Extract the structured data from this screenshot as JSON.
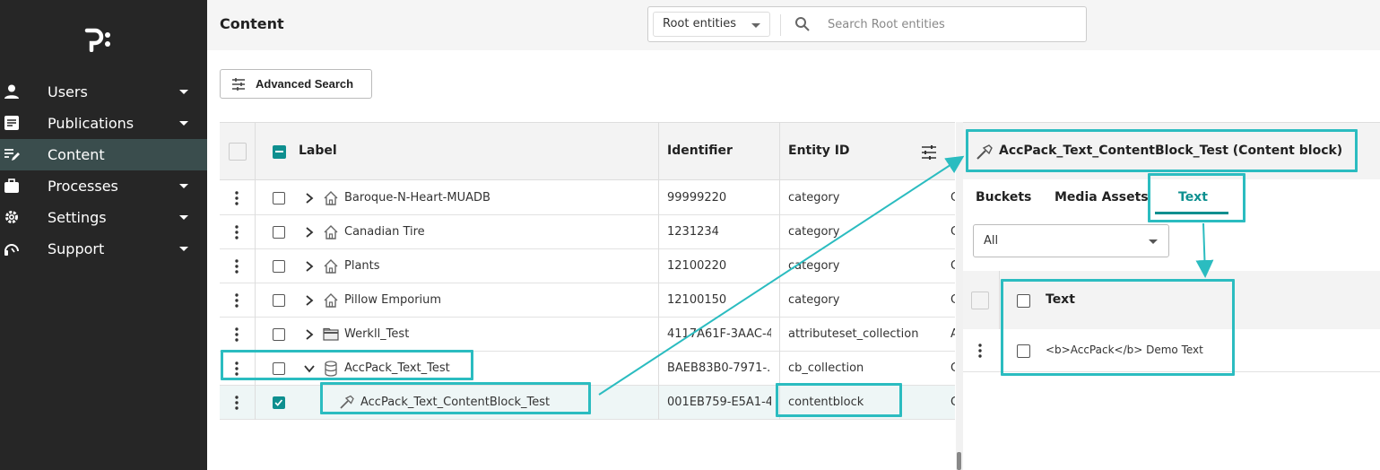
{
  "sidebar": {
    "logo_text": "p:",
    "items": [
      {
        "label": "Users",
        "icon": "person-icon",
        "has_caret": true,
        "active": false
      },
      {
        "label": "Publications",
        "icon": "document-icon",
        "has_caret": true,
        "active": false
      },
      {
        "label": "Content",
        "icon": "edit-list-icon",
        "has_caret": false,
        "active": true
      },
      {
        "label": "Processes",
        "icon": "briefcase-icon",
        "has_caret": true,
        "active": false
      },
      {
        "label": "Settings",
        "icon": "gear-icon",
        "has_caret": true,
        "active": false
      },
      {
        "label": "Support",
        "icon": "headset-icon",
        "has_caret": true,
        "active": false
      }
    ]
  },
  "header": {
    "title": "Content",
    "scope": "Root entities",
    "search_placeholder": "Search Root entities"
  },
  "toolbar": {
    "advanced_search_label": "Advanced Search"
  },
  "table": {
    "columns": {
      "label": "Label",
      "identifier": "Identifier",
      "entity_id": "Entity ID"
    },
    "rows": [
      {
        "label": "Baroque-N-Heart-MUADB",
        "identifier": "99999220",
        "entity_id": "category",
        "extra": "C",
        "icon": "home-icon",
        "expand": "chevron-right-icon",
        "checked": false
      },
      {
        "label": "Canadian Tire",
        "identifier": "1231234",
        "entity_id": "category",
        "extra": "C",
        "icon": "home-icon",
        "expand": "chevron-right-icon",
        "checked": false
      },
      {
        "label": "Plants",
        "identifier": "12100220",
        "entity_id": "category",
        "extra": "C",
        "icon": "home-icon",
        "expand": "chevron-right-icon",
        "checked": false
      },
      {
        "label": "Pillow Emporium",
        "identifier": "12100150",
        "entity_id": "category",
        "extra": "C",
        "icon": "home-icon",
        "expand": "chevron-right-icon",
        "checked": false
      },
      {
        "label": "Werkll_Test",
        "identifier": "4117A61F-3AAC-4...",
        "entity_id": "attributeset_collection",
        "extra": "A",
        "icon": "folder-icon",
        "expand": "chevron-right-icon",
        "checked": false
      },
      {
        "label": "AccPack_Text_Test",
        "identifier": "BAEB83B0-7971-...",
        "entity_id": "cb_collection",
        "extra": "C",
        "icon": "database-icon",
        "expand": "chevron-down-icon",
        "checked": false
      },
      {
        "label": "AccPack_Text_ContentBlock_Test",
        "identifier": "001EB759-E5A1-4...",
        "entity_id": "contentblock",
        "extra": "C",
        "icon": "hammer-icon",
        "expand": "",
        "checked": true
      }
    ]
  },
  "panel": {
    "title": "AccPack_Text_ContentBlock_Test (Content block)",
    "tabs": [
      "Buckets",
      "Media Assets",
      "Text"
    ],
    "active_tab": "Text",
    "filter_value": "All",
    "column_header": "Text",
    "rows": [
      {
        "text": "<b>AccPack</b> Demo Text"
      }
    ]
  },
  "colors": {
    "sidebar_bg": "#262626",
    "active_nav_bg": "#3a4d4d",
    "accent": "#0e8f8f",
    "annotation": "#2bbcc0"
  }
}
